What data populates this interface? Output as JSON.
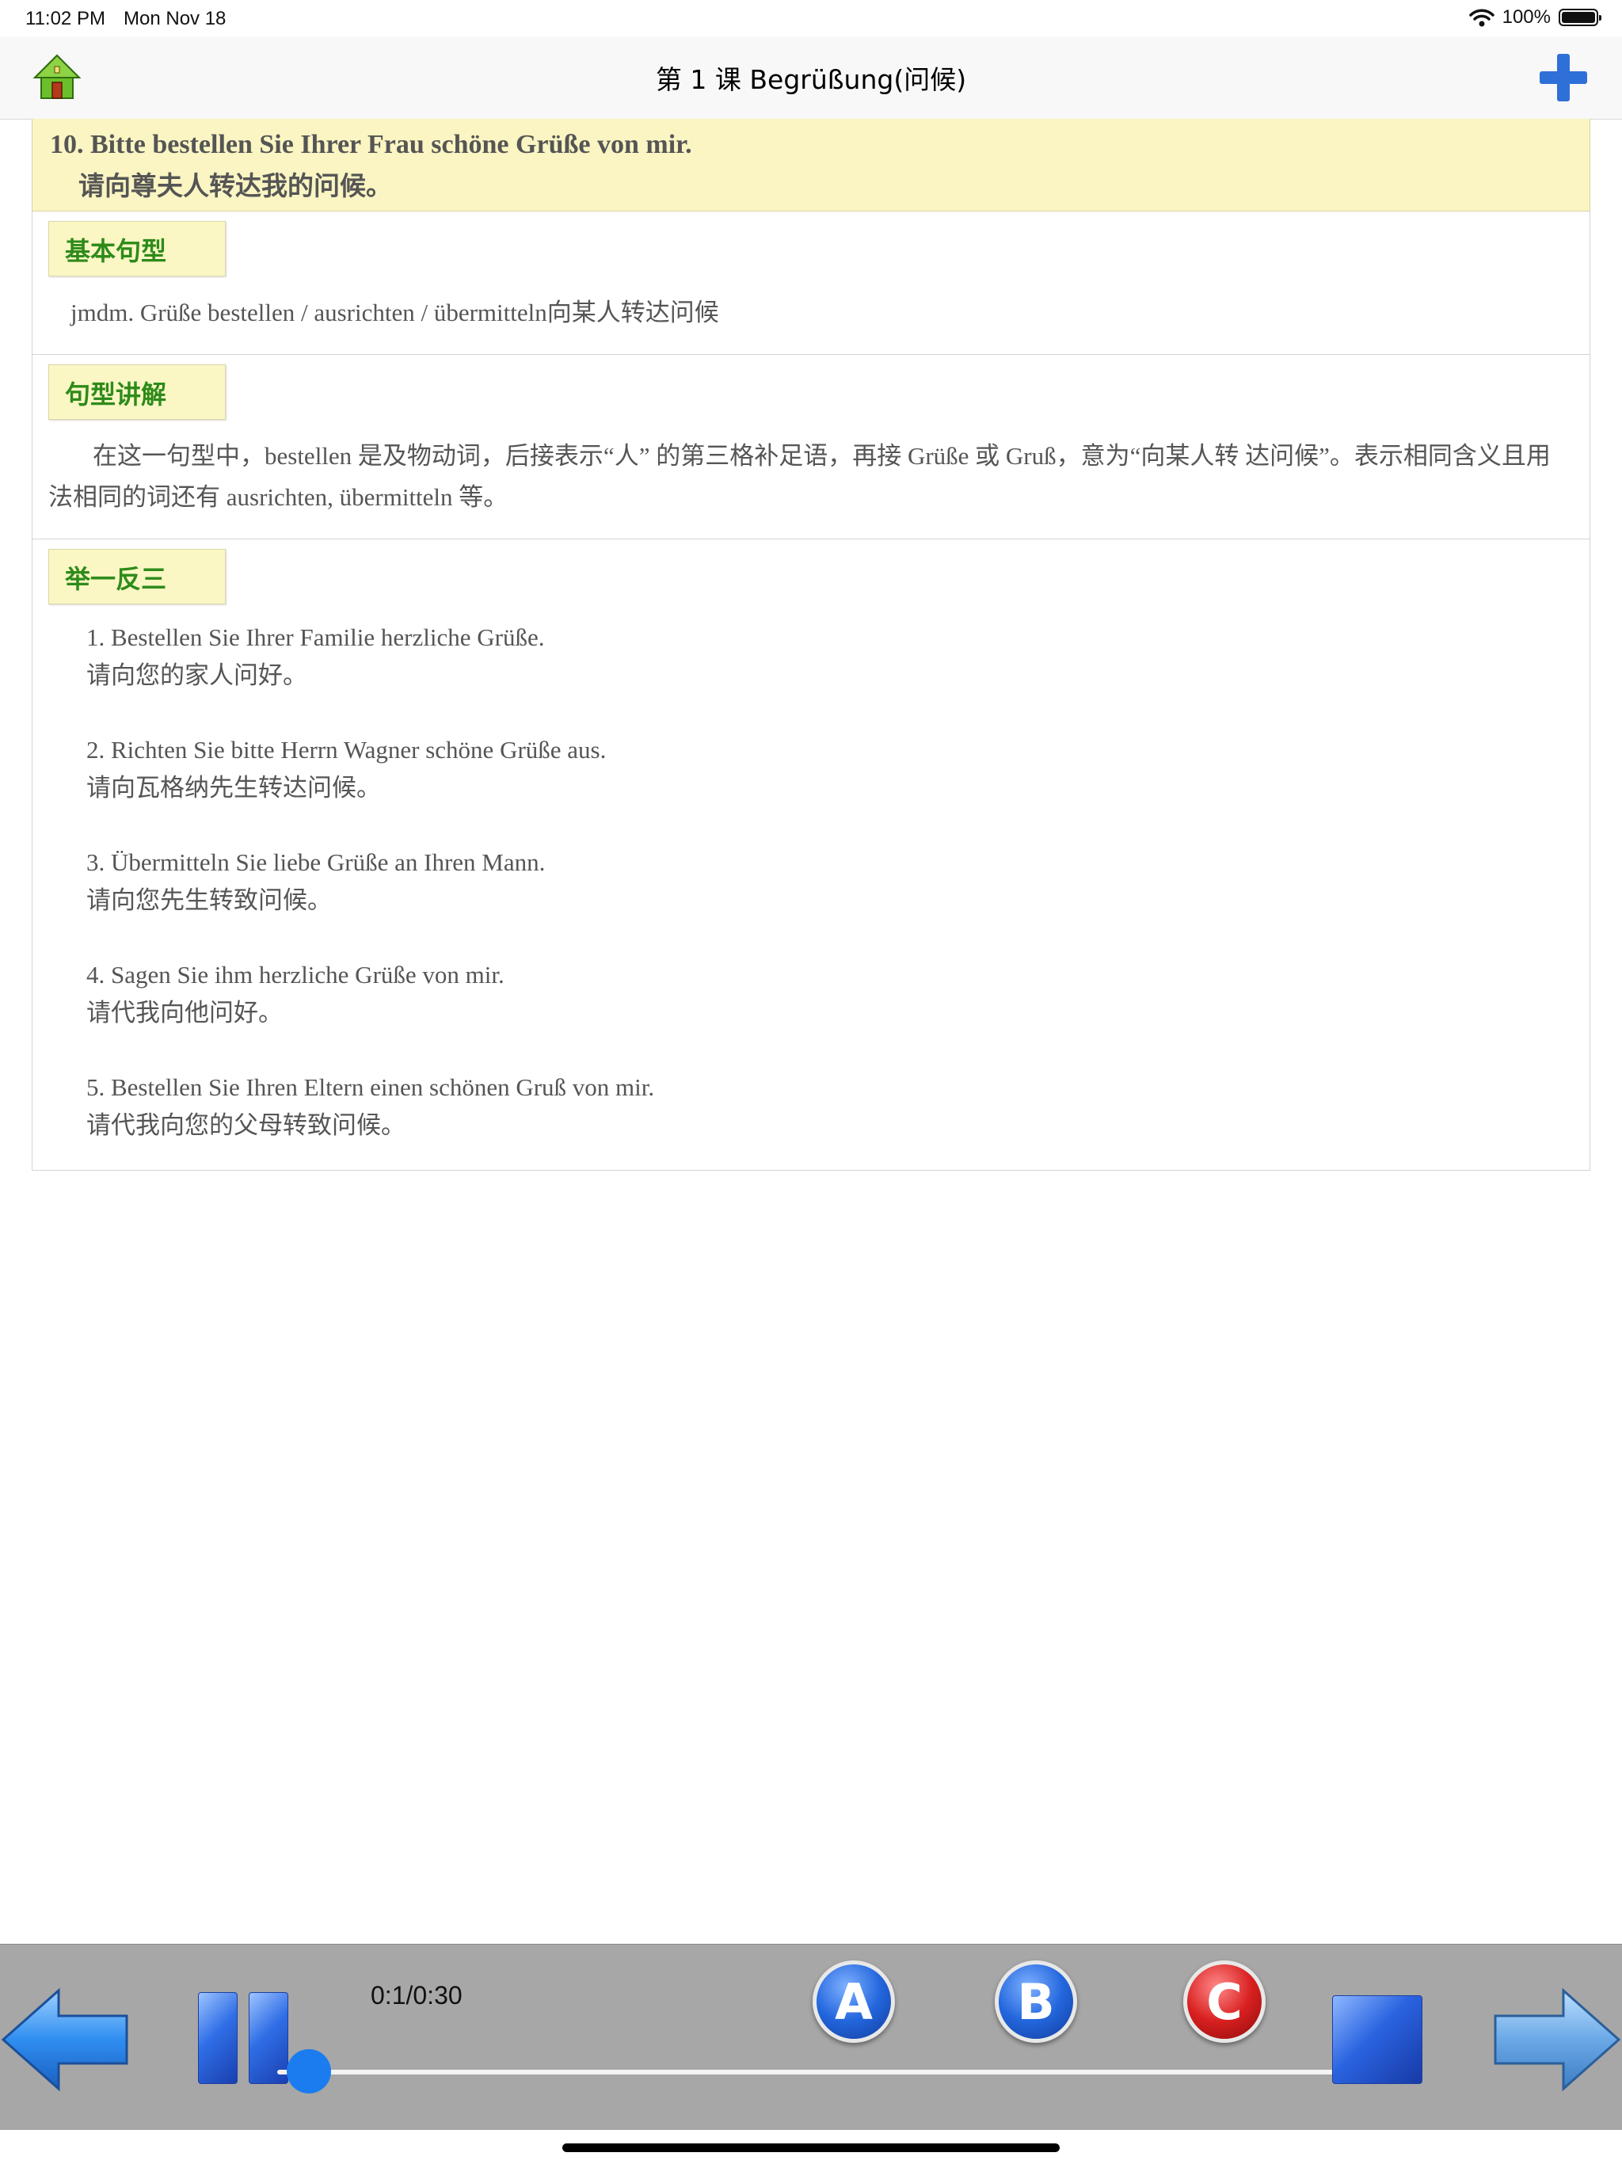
{
  "status_bar": {
    "time": "11:02 PM",
    "date": "Mon Nov 18",
    "battery": "100%"
  },
  "nav": {
    "title": "第 1 课 Begrüßung(问候)"
  },
  "sentence": {
    "german": "10. Bitte bestellen Sie Ihrer Frau schöne Grüße von mir.",
    "chinese": "请向尊夫人转达我的问候。"
  },
  "sections": {
    "pattern": {
      "tag": "基本句型",
      "text": "jmdm. Grüße bestellen / ausrichten / übermitteln向某人转达问候"
    },
    "explanation": {
      "tag": "句型讲解",
      "text": "在这一句型中，bestellen 是及物动词，后接表示“人” 的第三格补足语，再接 Grüße 或 Gruß，意为“向某人转 达问候”。表示相同含义且用法相同的词还有 ausrichten, übermitteln 等。"
    },
    "examples": {
      "tag": "举一反三",
      "items": [
        {
          "de": "1. Bestellen Sie Ihrer Familie herzliche Grüße.",
          "zh": "请向您的家人问好。"
        },
        {
          "de": "2. Richten Sie bitte Herrn Wagner schöne Grüße aus.",
          "zh": "请向瓦格纳先生转达问候。"
        },
        {
          "de": "3. Übermitteln Sie liebe Grüße an Ihren Mann.",
          "zh": "请向您先生转致问候。"
        },
        {
          "de": "4. Sagen Sie ihm herzliche Grüße von mir.",
          "zh": "请代我向他问好。"
        },
        {
          "de": "5. Bestellen Sie Ihren Eltern einen schönen Gruß von mir.",
          "zh": "请代我向您的父母转致问候。"
        }
      ]
    }
  },
  "player": {
    "timecode": "0:1/0:30",
    "progress": 0.03,
    "buttons": {
      "a": "A",
      "b": "B",
      "c": "C"
    }
  },
  "colors": {
    "accent": "#1b7cf0",
    "tag_text": "#2e8b1a",
    "header_bg": "#faf5c2",
    "toolbar_bg": "#a7a7a7"
  }
}
